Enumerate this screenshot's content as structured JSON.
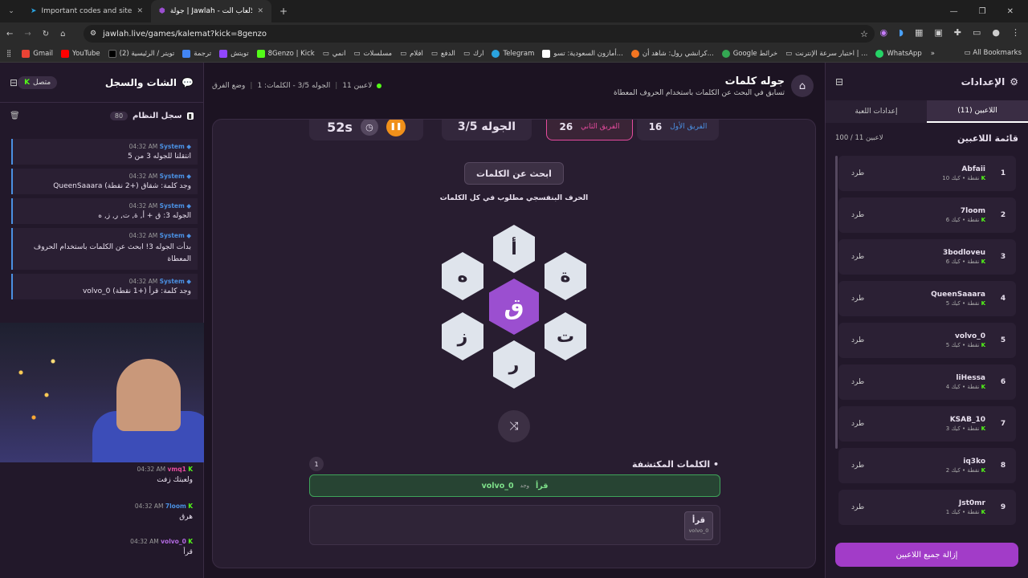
{
  "browser": {
    "tabs": [
      {
        "title": "Important codes and sites | عجيبة"
      },
      {
        "title": "جولة | Jawlah - منصة الألعاب الت..."
      }
    ],
    "url": "jawlah.live/games/kalemat?kick=8genzo",
    "bookmarks": [
      "Gmail",
      "YouTube",
      "(2) تويتر / الرئيسية",
      "ترجمة",
      "تويتش",
      "8Genzo | Kick",
      "انمي",
      "مسلسلات",
      "افلام",
      "الدفع",
      "ارك",
      "Telegram",
      "أمازون السعودية: تسو...",
      "كرانشي رول: شاهد أن...",
      "Google خرائط",
      "اختبار سرعة الإنترنت | ...",
      "WhatsApp"
    ],
    "all_bookmarks": "All Bookmarks",
    "bookmark_colors": [
      "#ea4335",
      "#ff0000",
      "#000000",
      "#4285f4",
      "#9146ff",
      "#53fc18",
      "#777777",
      "#777777",
      "#777777",
      "#777777",
      "#777777",
      "#2aa3e0",
      "#ffffff",
      "#f47521",
      "#34a853",
      "#777777",
      "#25d366"
    ]
  },
  "chat": {
    "title": "الشات والسجل",
    "status": "متصل",
    "log_title": "سجل النظام",
    "log_count": "80",
    "system_messages": [
      {
        "sender": "System",
        "time": "04:32 AM",
        "text": "انتقلنا للجوله 3 من 5"
      },
      {
        "sender": "System",
        "time": "04:32 AM",
        "text": "QueenSaaara وجد كلمة: شقاق (+2 نقطة)"
      },
      {
        "sender": "System",
        "time": "04:32 AM",
        "text": "الجوله 3: ق + أ, ة, ت, ر, ز, ه"
      },
      {
        "sender": "System",
        "time": "04:32 AM",
        "text": "بدأت الجوله 3! ابحث عن الكلمات باستخدام الحروف المعطاة"
      },
      {
        "sender": "System",
        "time": "04:32 AM",
        "text": "volvo_0 وجد كلمة: قرأ (+1 نقطة)"
      }
    ],
    "user_messages": [
      {
        "user": "vmq1",
        "time": "04:32 AM",
        "text": "ولعبتك زفت",
        "color": "#e54b9e"
      },
      {
        "user": "7loom",
        "time": "04:32 AM",
        "text": "هرق",
        "color": "#4a90e2"
      },
      {
        "user": "volvo_0",
        "time": "04:32 AM",
        "text": "قرأ",
        "color": "#b36ae2"
      }
    ]
  },
  "game": {
    "title": "جوله كلمات",
    "subtitle": "تسابق في البحث عن الكلمات باستخدام الحروف المعطاة",
    "players_online": "11 لاعبين",
    "round_info": "الجوله 3/5 - الكلمات: 1",
    "mode": "وضع الفرق",
    "team1": {
      "label": "الفريق الأول",
      "score": "16"
    },
    "team2": {
      "label": "الفريق الثاني",
      "score": "26"
    },
    "round_label": "الجوله 3/5",
    "timer": "52s",
    "find_button": "ابحث عن الكلمات",
    "hint": "الحرف البنفسجي مطلوب في كل الكلمات",
    "letters": {
      "center": "ق",
      "top": "أ",
      "top_right": "ة",
      "bottom_right": "ت",
      "bottom": "ر",
      "bottom_left": "ز",
      "top_left": "ه"
    },
    "found_title": "الكلمات المكتشفة",
    "found_count": "1",
    "found_entry": {
      "word": "قرأ",
      "verb": "وجد",
      "player": "volvo_0"
    },
    "word_chip": {
      "word": "قرأ",
      "player": "volvo_0"
    }
  },
  "settings": {
    "title": "الإعدادات",
    "tab_players": "اللاعبين (11)",
    "tab_game": "إعدادات اللعبة",
    "list_title": "قائمة اللاعبين",
    "list_count": "100 / 11 لاعبين",
    "kick_label": "طرد",
    "platform": "كيك",
    "players": [
      {
        "rank": "1",
        "name": "Abfaii",
        "points": "10 نقطة"
      },
      {
        "rank": "2",
        "name": "7loom",
        "points": "6 نقطة"
      },
      {
        "rank": "3",
        "name": "3bodloveu",
        "points": "6 نقطة"
      },
      {
        "rank": "4",
        "name": "QueenSaaara",
        "points": "5 نقطة"
      },
      {
        "rank": "5",
        "name": "volvo_0",
        "points": "5 نقطة"
      },
      {
        "rank": "6",
        "name": "liHessa",
        "points": "4 نقطة"
      },
      {
        "rank": "7",
        "name": "KSAB_10",
        "points": "3 نقطة"
      },
      {
        "rank": "8",
        "name": "iq3ko",
        "points": "2 نقطة"
      },
      {
        "rank": "9",
        "name": "Jst0mr",
        "points": "1 نقطة"
      }
    ],
    "remove_all": "إزالة جميع اللاعبين"
  }
}
